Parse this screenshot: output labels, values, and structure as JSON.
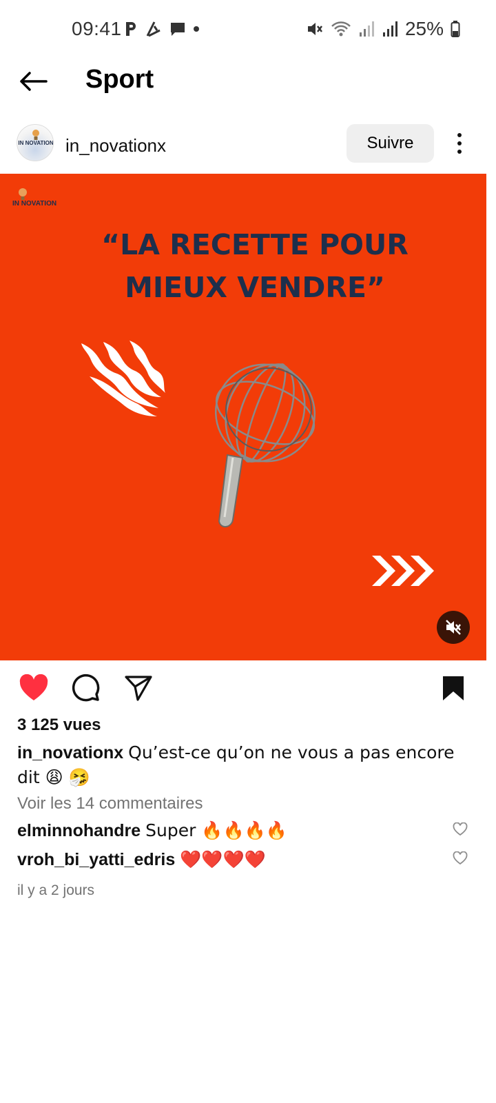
{
  "status_bar": {
    "time": "09:41",
    "battery": "25%",
    "left_icons": [
      "parking-icon",
      "flag-icon",
      "chat-icon",
      "dot-icon"
    ],
    "right_icons": [
      "mute-icon",
      "wifi-icon",
      "signal-icon",
      "signal-icon",
      "battery-icon"
    ]
  },
  "header": {
    "title": "Sport"
  },
  "post": {
    "username": "in_novationx",
    "avatar_text": "IN NOVATION",
    "follow_label": "Suivre",
    "media": {
      "logo_text": "IN NOVATION",
      "headline_line1": "“LA RECETTE POUR",
      "headline_line2": "MIEUX VENDRE”",
      "background_color": "#f23c08",
      "headline_color": "#1d2f4c"
    },
    "views": "3 125 vues",
    "caption_user": "in_novationx",
    "caption_text": "Qu’est-ce qu’on ne vous a pas encore dit 😩 🤧",
    "view_comments": "Voir les 14 commentaires",
    "comments": [
      {
        "user": "elminnohandre",
        "text": "Super 🔥🔥🔥🔥"
      },
      {
        "user": "vroh_bi_yatti_edris",
        "text": "❤️❤️❤️❤️"
      }
    ],
    "timestamp": "il y a 2 jours",
    "liked": true,
    "saved": true,
    "accent_like_color": "#ff3040"
  }
}
